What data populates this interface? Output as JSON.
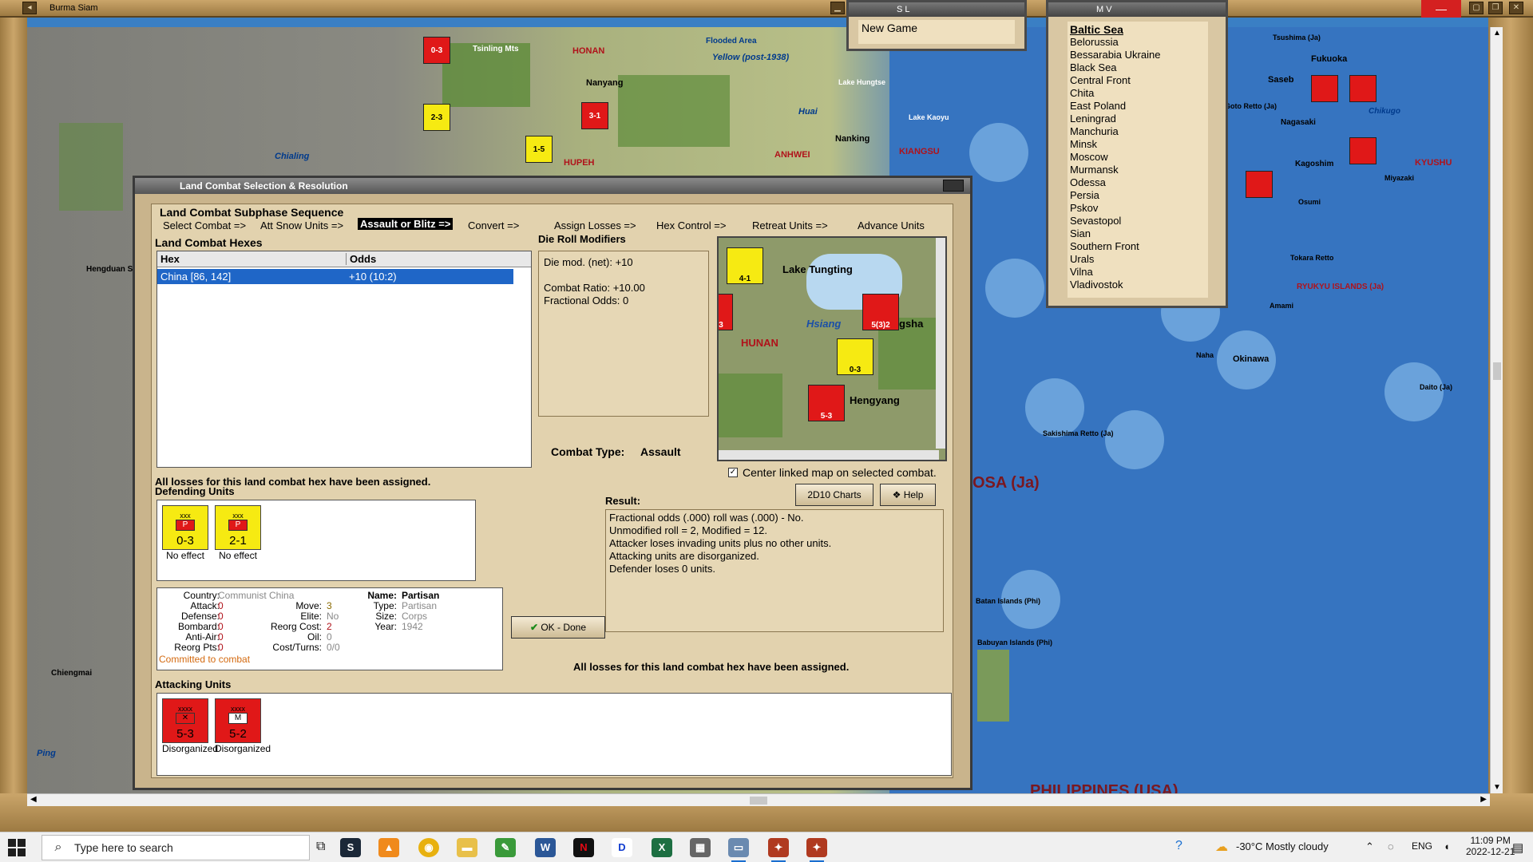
{
  "window": {
    "map_title": "Burma Siam"
  },
  "map": {
    "labels": {
      "tsinling": "Tsinling Mts",
      "honan": "HONAN",
      "flooded": "Flooded Area",
      "yellow": "Yellow (post-1938)",
      "nanyang": "Nanyang",
      "lake_hungtse": "Lake Hungtse",
      "huai": "Huai",
      "lake_kaoyu": "Lake Kaoyu",
      "nanking": "Nanking",
      "chialing": "Chialing",
      "hupeh": "HUPEH",
      "anhwei": "ANHWEI",
      "kiangsu": "KIANGSU",
      "hengduan": "Hengduan S",
      "chiengmai": "Chiengmai",
      "ping": "Ping",
      "tsushima": "Tsushima (Ja)",
      "fukuoka": "Fukuoka",
      "saseb": "Saseb",
      "goto": "Goto Retto (Ja)",
      "nagasaki": "Nagasaki",
      "chikugo": "Chikugo",
      "kagoshima": "Kagoshim",
      "kyushu": "KYUSHU",
      "miyazaki": "Miyazaki",
      "osumi": "Osumi",
      "tokara": "Tokara Retto",
      "ryukyu": "RYUKYU ISLANDS (Ja)",
      "amami": "Amami",
      "naha": "Naha",
      "okinawa": "Okinawa",
      "daito": "Daito (Ja)",
      "sakishima": "Sakishima Retto (Ja)",
      "formosa": "OSA (Ja)",
      "batan": "Batan Islands (Phi)",
      "babuyan": "Babuyan Islands (Phi)",
      "philippines": "PHILIPPINES (USA)"
    },
    "counters": [
      "0-3",
      "2-3",
      "1-5",
      "3-1"
    ]
  },
  "sl_panel": {
    "title": "S L",
    "item": "New Game"
  },
  "mv_panel": {
    "title": "M V",
    "heading": "Baltic Sea",
    "items": [
      "Belorussia",
      "Bessarabia Ukraine",
      "Black Sea",
      "Central Front",
      "Chita",
      "East Poland",
      "Leningrad",
      "Manchuria",
      "Minsk",
      "Moscow",
      "Murmansk",
      "Odessa",
      "Persia",
      "Pskov",
      "Sevastopol",
      "Sian",
      "Southern Front",
      "Urals",
      "Vilna",
      "Vladivostok"
    ]
  },
  "dialog": {
    "title": "Land Combat Selection & Resolution",
    "subphase_heading": "Land Combat Subphase Sequence",
    "phases": [
      {
        "label": "Select Combat =>",
        "active": false
      },
      {
        "label": "Att Snow Units =>",
        "active": false
      },
      {
        "label": "Assault or Blitz =>",
        "active": true
      },
      {
        "label": "Convert =>",
        "active": false
      },
      {
        "label": "Assign Losses =>",
        "active": false
      },
      {
        "label": "Hex Control =>",
        "active": false
      },
      {
        "label": "Retreat Units =>",
        "active": false
      },
      {
        "label": "Advance Units",
        "active": false
      }
    ],
    "hexes_heading": "Land Combat Hexes",
    "hex_columns": [
      "Hex",
      "Odds"
    ],
    "hex_rows": [
      {
        "hex": "China [86, 142]",
        "odds": "+10 (10:2)"
      }
    ],
    "drm_heading": "Die Roll Modifiers",
    "drm_lines": [
      "Die mod. (net): +10",
      "",
      "Combat Ratio: +10.00",
      "Fractional Odds: 0"
    ],
    "combat_type_label": "Combat Type:",
    "combat_type_value": "Assault",
    "mini_map": {
      "lake": "Lake Tungting",
      "hsiang": "Hsiang",
      "hunan": "HUNAN",
      "changsha": "gsha",
      "hengyang": "Hengyang",
      "counters": [
        "4-1",
        "5(3)2",
        "0-3",
        "5-3",
        "3"
      ]
    },
    "center_linked_label": "Center linked map on selected combat.",
    "center_linked_checked": true,
    "charts_button": "2D10 Charts",
    "help_button": "Help",
    "losses_assigned_top": "All losses for this land combat hex have been assigned.",
    "defending_heading": "Defending Units",
    "defenders": [
      {
        "flag": "P",
        "size": "xxx",
        "strength": "0-3",
        "status": "No effect"
      },
      {
        "flag": "P",
        "size": "xxx",
        "strength": "2-1",
        "status": "No effect"
      }
    ],
    "unit_info": {
      "country_k": "Country:",
      "country_v": "Communist China",
      "attack_k": "Attack:",
      "attack_v": "0",
      "defense_k": "Defense:",
      "defense_v": "0",
      "bombard_k": "Bombard:",
      "bombard_v": "0",
      "antiair_k": "Anti-Air:",
      "antiair_v": "0",
      "reorg_pts_k": "Reorg Pts:",
      "reorg_pts_v": "0",
      "move_k": "Move:",
      "move_v": "3",
      "elite_k": "Elite:",
      "elite_v": "No",
      "reorg_cost_k": "Reorg Cost:",
      "reorg_cost_v": "2",
      "oil_k": "Oil:",
      "oil_v": "0",
      "cost_turns_k": "Cost/Turns:",
      "cost_turns_v": "0/0",
      "name_k": "Name:",
      "name_v": "Partisan",
      "type_k": "Type:",
      "type_v": "Partisan",
      "size_k": "Size:",
      "size_v": "Corps",
      "year_k": "Year:",
      "year_v": "1942",
      "committed": "Committed to combat"
    },
    "ok_button": "OK - Done",
    "result_heading": "Result:",
    "result_lines": [
      "Fractional odds (.000) roll was (.000)  - No.",
      "Unmodified roll = 2, Modified = 12.",
      "Attacker loses invading units plus no other units.",
      "Attacking units are disorganized.",
      "Defender loses 0 units."
    ],
    "losses_assigned_bottom": "All losses for this land combat hex have been assigned.",
    "attacking_heading": "Attacking Units",
    "attackers": [
      {
        "size": "xxxx",
        "strength": "5-3",
        "status": "Disorganized"
      },
      {
        "size": "xxxx",
        "strength": "5-2",
        "status": "Disorganized"
      }
    ]
  },
  "taskbar": {
    "search_placeholder": "Type here to search",
    "weather": "-30°C  Mostly cloudy",
    "lang": "ENG",
    "time": "11:09 PM",
    "date": "2022-12-21"
  }
}
